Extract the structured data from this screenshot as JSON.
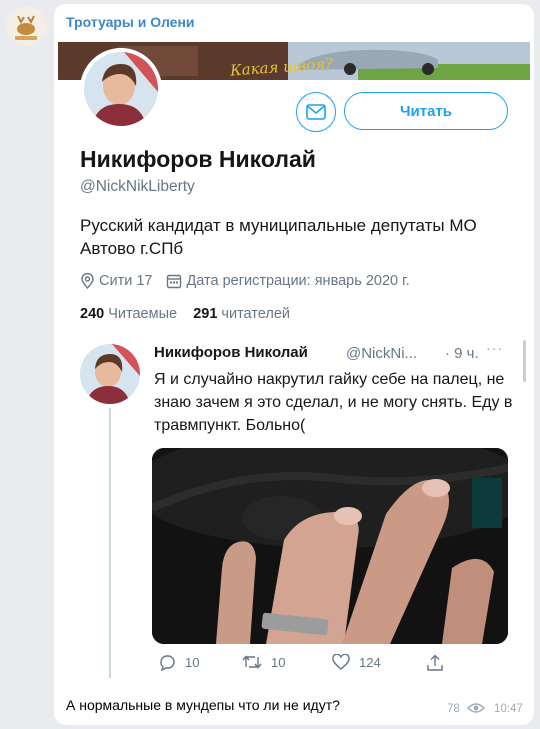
{
  "channel": {
    "name": "Тротуары и Олени",
    "caption": "А нормальные в мундепы что ли не идут?",
    "views": "78",
    "time": "10:47"
  },
  "profile": {
    "banner_text": "Какая швоя?",
    "name": "Никифоров Николай",
    "handle": "@NickNikLiberty",
    "bio": "Русский кандидат в муниципальные депутаты МО Автово г.СПб",
    "location": "Сити 17",
    "joined": "Дата регистрации: январь 2020 г.",
    "following_count": "240",
    "following_label": "Читаемые",
    "followers_count": "291",
    "followers_label": "читателей",
    "follow_button": "Читать",
    "accent": "#1da1f2"
  },
  "tweet": {
    "name": "Никифоров Николай",
    "handle": "@NickNi...",
    "time": "· 9 ч.",
    "more": "···",
    "text": "Я и случайно накрутил гайку себе на палец, не знаю зачем я это сделал, и не могу снять. Еду в травмпункт. Больно(",
    "replies": "10",
    "retweets": "10",
    "likes": "124"
  },
  "icons": [
    "channel-logo-icon",
    "envelope-icon",
    "location-pin-icon",
    "calendar-icon",
    "reply-icon",
    "retweet-icon",
    "heart-icon",
    "share-icon",
    "eye-icon"
  ]
}
